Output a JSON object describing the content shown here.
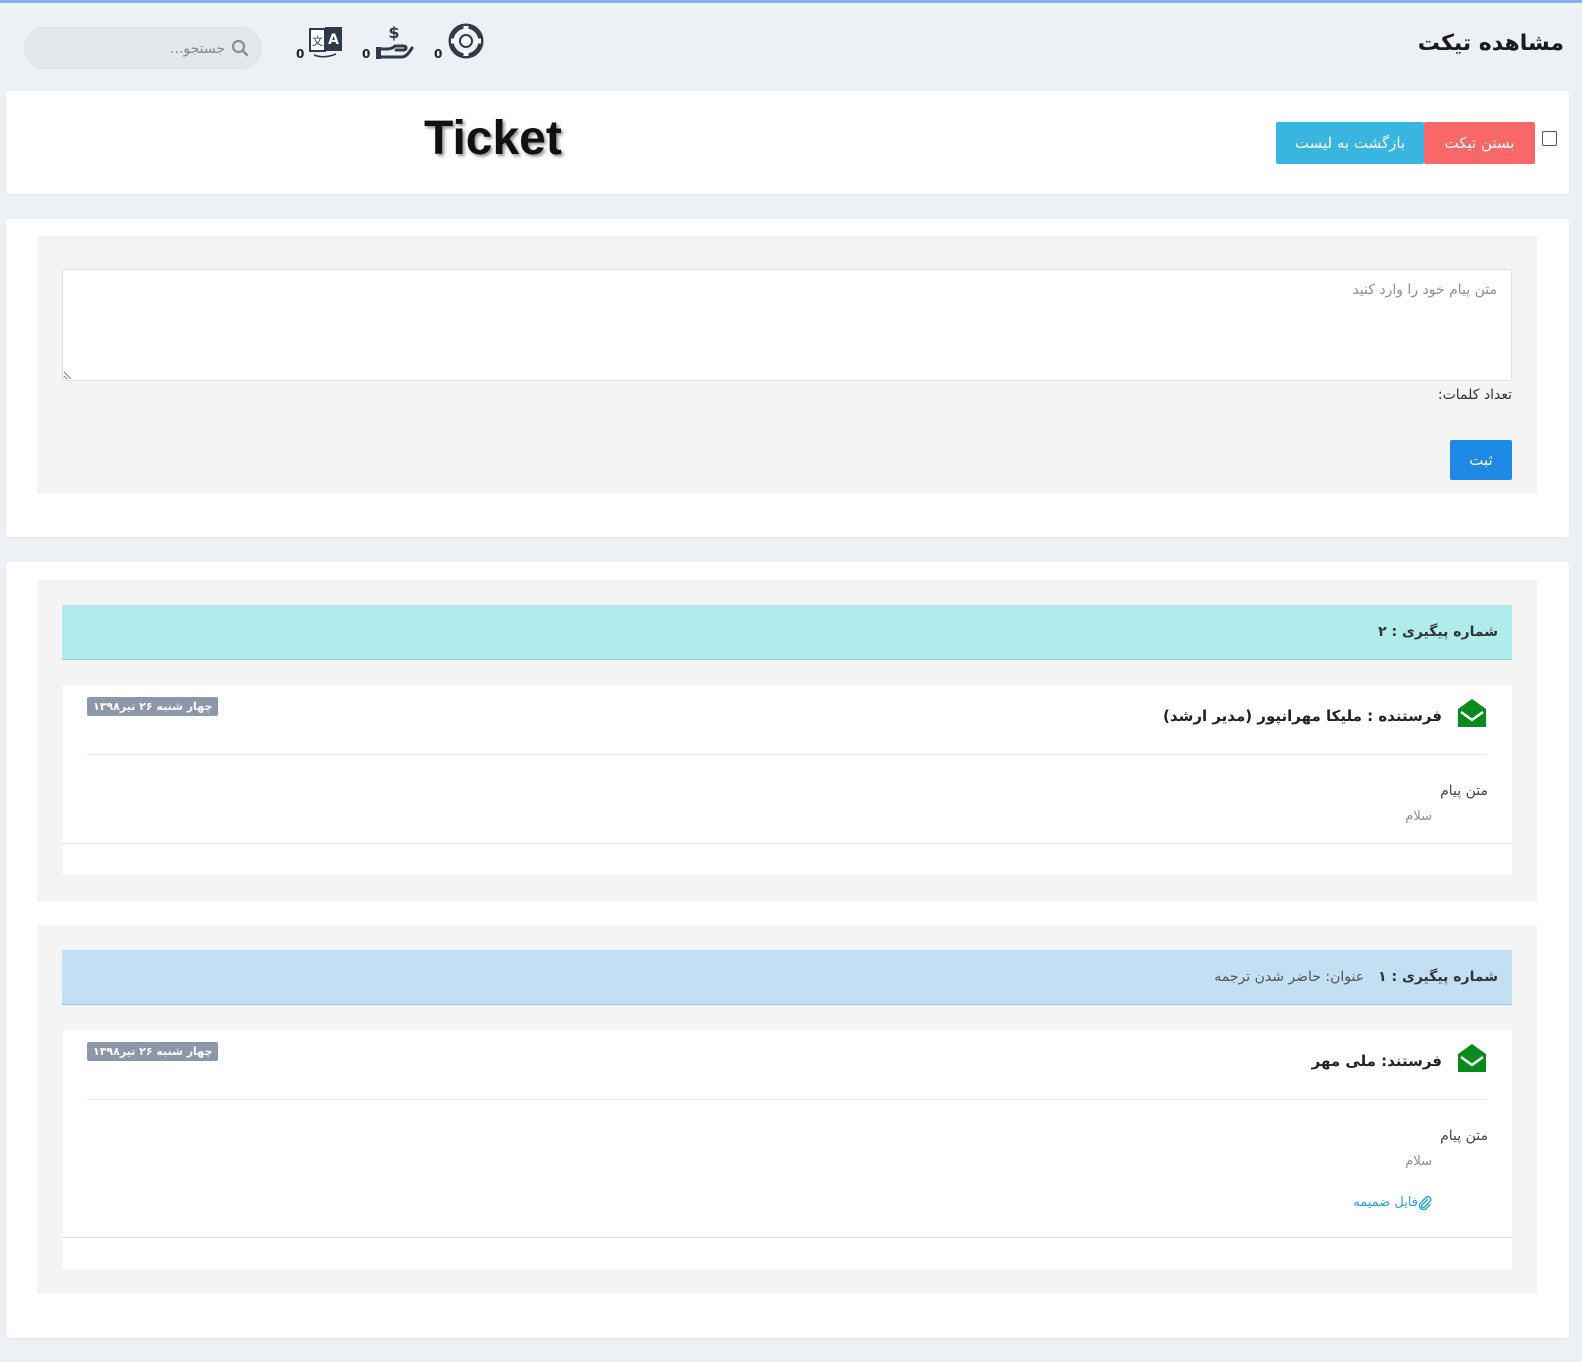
{
  "header": {
    "page_title": "مشاهده تیکت",
    "search_placeholder": "جستجو...",
    "icons": [
      {
        "name": "support-icon",
        "count": "0"
      },
      {
        "name": "money-hand-icon",
        "count": "0"
      },
      {
        "name": "translate-icon",
        "count": "0"
      }
    ]
  },
  "toolbar": {
    "watermark": "Ticket",
    "close_label": "بستن تیکت",
    "back_label": "بازگشت به لیست"
  },
  "reply": {
    "placeholder": "متن پیام خود را وارد کنید",
    "word_count_label": "تعداد کلمات:",
    "submit_label": "ثبت"
  },
  "messages": [
    {
      "tracking_label": "شماره پیگیری : ۲",
      "title": "",
      "sender": "فرستنده : ملیکا مهرانپور (مدیر ارشد)",
      "date": "چهار شنبه ۲۶ تیر۱۳۹۸",
      "body_label": "متن پیام",
      "body_text": "سلام",
      "attachment": ""
    },
    {
      "tracking_label": "شماره پیگیری : ۱",
      "title": "عنوان: حاضر شدن ترجمه",
      "sender": "فرستند: ملی مهر",
      "date": "چهار شنبه ۲۶ تیر۱۳۹۸",
      "body_label": "متن پیام",
      "body_text": "سلام",
      "attachment": "فایل ضمیمه"
    }
  ],
  "colors": {
    "accent": "#1e88e5",
    "close_button": "#f96868",
    "back_button": "#38b6e0",
    "envelope": "#0a8a1e",
    "message1_header": "#b0ecec",
    "message2_header": "#c3dff4"
  }
}
